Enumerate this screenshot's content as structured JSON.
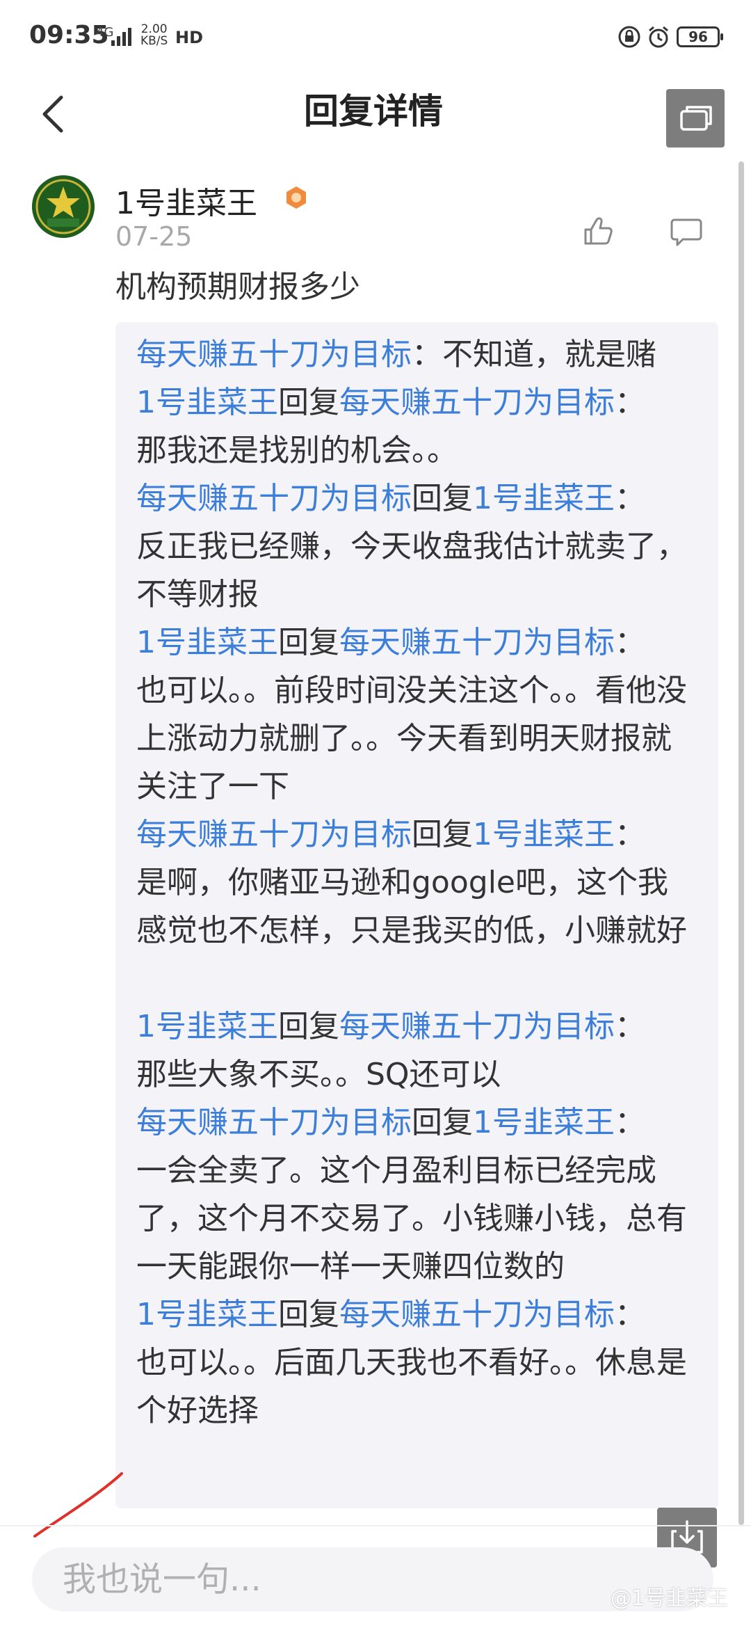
{
  "status_bar": {
    "time": "09:35",
    "network": "4G",
    "speed_value": "2.00",
    "speed_unit": "KB/S",
    "hd": "HD",
    "battery": "96"
  },
  "header": {
    "title": "回复详情"
  },
  "comment": {
    "author": "1号韭菜王",
    "date": "07-25",
    "text": "机构预期财报多少"
  },
  "replies": [
    {
      "author": "每天赚五十刀为目标",
      "reply_word": "",
      "target": "",
      "content": "不知道，就是赌"
    },
    {
      "author": "1号韭菜王",
      "reply_word": "回复",
      "target": "每天赚五十刀为目标",
      "content": "那我还是找别的机会。。"
    },
    {
      "author": "每天赚五十刀为目标",
      "reply_word": "回复",
      "target": "1号韭菜王",
      "content": "反正我已经赚，今天收盘我估计就卖了，不等财报"
    },
    {
      "author": "1号韭菜王",
      "reply_word": "回复",
      "target": "每天赚五十刀为目标",
      "content": "也可以。。前段时间没关注这个。。看他没上涨动力就删了。。今天看到明天财报就关注了一下"
    },
    {
      "author": "每天赚五十刀为目标",
      "reply_word": "回复",
      "target": "1号韭菜王",
      "content": "是啊，你赌亚马逊和google吧，这个我感觉也不怎样，只是我买的低，小赚就好"
    },
    {
      "author": "1号韭菜王",
      "reply_word": "回复",
      "target": "每天赚五十刀为目标",
      "content": "那些大象不买。。SQ还可以"
    },
    {
      "author": "每天赚五十刀为目标",
      "reply_word": "回复",
      "target": "1号韭菜王",
      "content": "一会全卖了。这个月盈利目标已经完成了，这个月不交易了。小钱赚小钱，总有一天能跟你一样一天赚四位数的"
    },
    {
      "author": "1号韭菜王",
      "reply_word": "回复",
      "target": "每天赚五十刀为目标",
      "content": "也可以。。后面几天我也不看好。。休息是个好选择"
    }
  ],
  "input": {
    "placeholder": "我也说一句..."
  },
  "watermark": "@1号韭菜王",
  "colors": {
    "link": "#3d7fd8",
    "reply_bg": "#f4f4f8",
    "badge": "#f08a3c",
    "annotation": "#e0302a"
  }
}
